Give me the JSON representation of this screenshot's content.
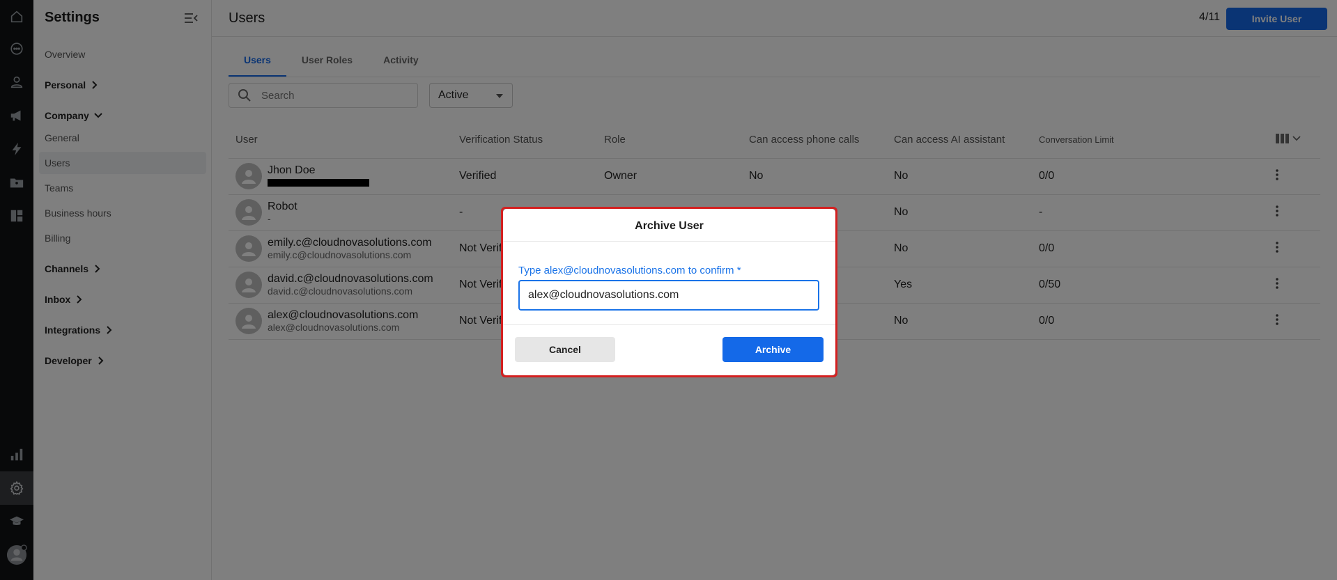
{
  "sidebar": {
    "title": "Settings",
    "overview": "Overview",
    "personal": "Personal",
    "company": "Company",
    "company_items": [
      "General",
      "Users",
      "Teams",
      "Business hours",
      "Billing"
    ],
    "channels": "Channels",
    "inbox": "Inbox",
    "integrations": "Integrations",
    "developer": "Developer"
  },
  "header": {
    "title": "Users",
    "counter": "4/11",
    "invite_label": "Invite User"
  },
  "tabs": [
    "Users",
    "User Roles",
    "Activity"
  ],
  "filters": {
    "search_placeholder": "Search",
    "status_value": "Active"
  },
  "table": {
    "columns": [
      "User",
      "Verification Status",
      "Role",
      "Can access phone calls",
      "Can access AI assistant",
      "Conversation Limit"
    ],
    "rows": [
      {
        "name": "Jhon Doe",
        "email": "",
        "verification": "Verified",
        "role": "Owner",
        "phone": "No",
        "ai": "No",
        "limit": "0/0"
      },
      {
        "name": "Robot",
        "email": "-",
        "verification": "-",
        "role": "",
        "phone": "",
        "ai": "No",
        "limit": "-"
      },
      {
        "name": "emily.c@cloudnovasolutions.com",
        "email": "emily.c@cloudnovasolutions.com",
        "verification": "Not Verif",
        "role": "",
        "phone": "",
        "ai": "No",
        "limit": "0/0"
      },
      {
        "name": "david.c@cloudnovasolutions.com",
        "email": "david.c@cloudnovasolutions.com",
        "verification": "Not Verif",
        "role": "",
        "phone": "",
        "ai": "Yes",
        "limit": "0/50"
      },
      {
        "name": "alex@cloudnovasolutions.com",
        "email": "alex@cloudnovasolutions.com",
        "verification": "Not Verif",
        "role": "",
        "phone": "",
        "ai": "No",
        "limit": "0/0"
      }
    ]
  },
  "modal": {
    "title": "Archive User",
    "label": "Type alex@cloudnovasolutions.com to confirm *",
    "input_value": "alex@cloudnovasolutions.com",
    "cancel_label": "Cancel",
    "archive_label": "Archive"
  },
  "colors": {
    "accent": "#1469e8",
    "rail": "#101214",
    "highlight": "#d42020"
  }
}
